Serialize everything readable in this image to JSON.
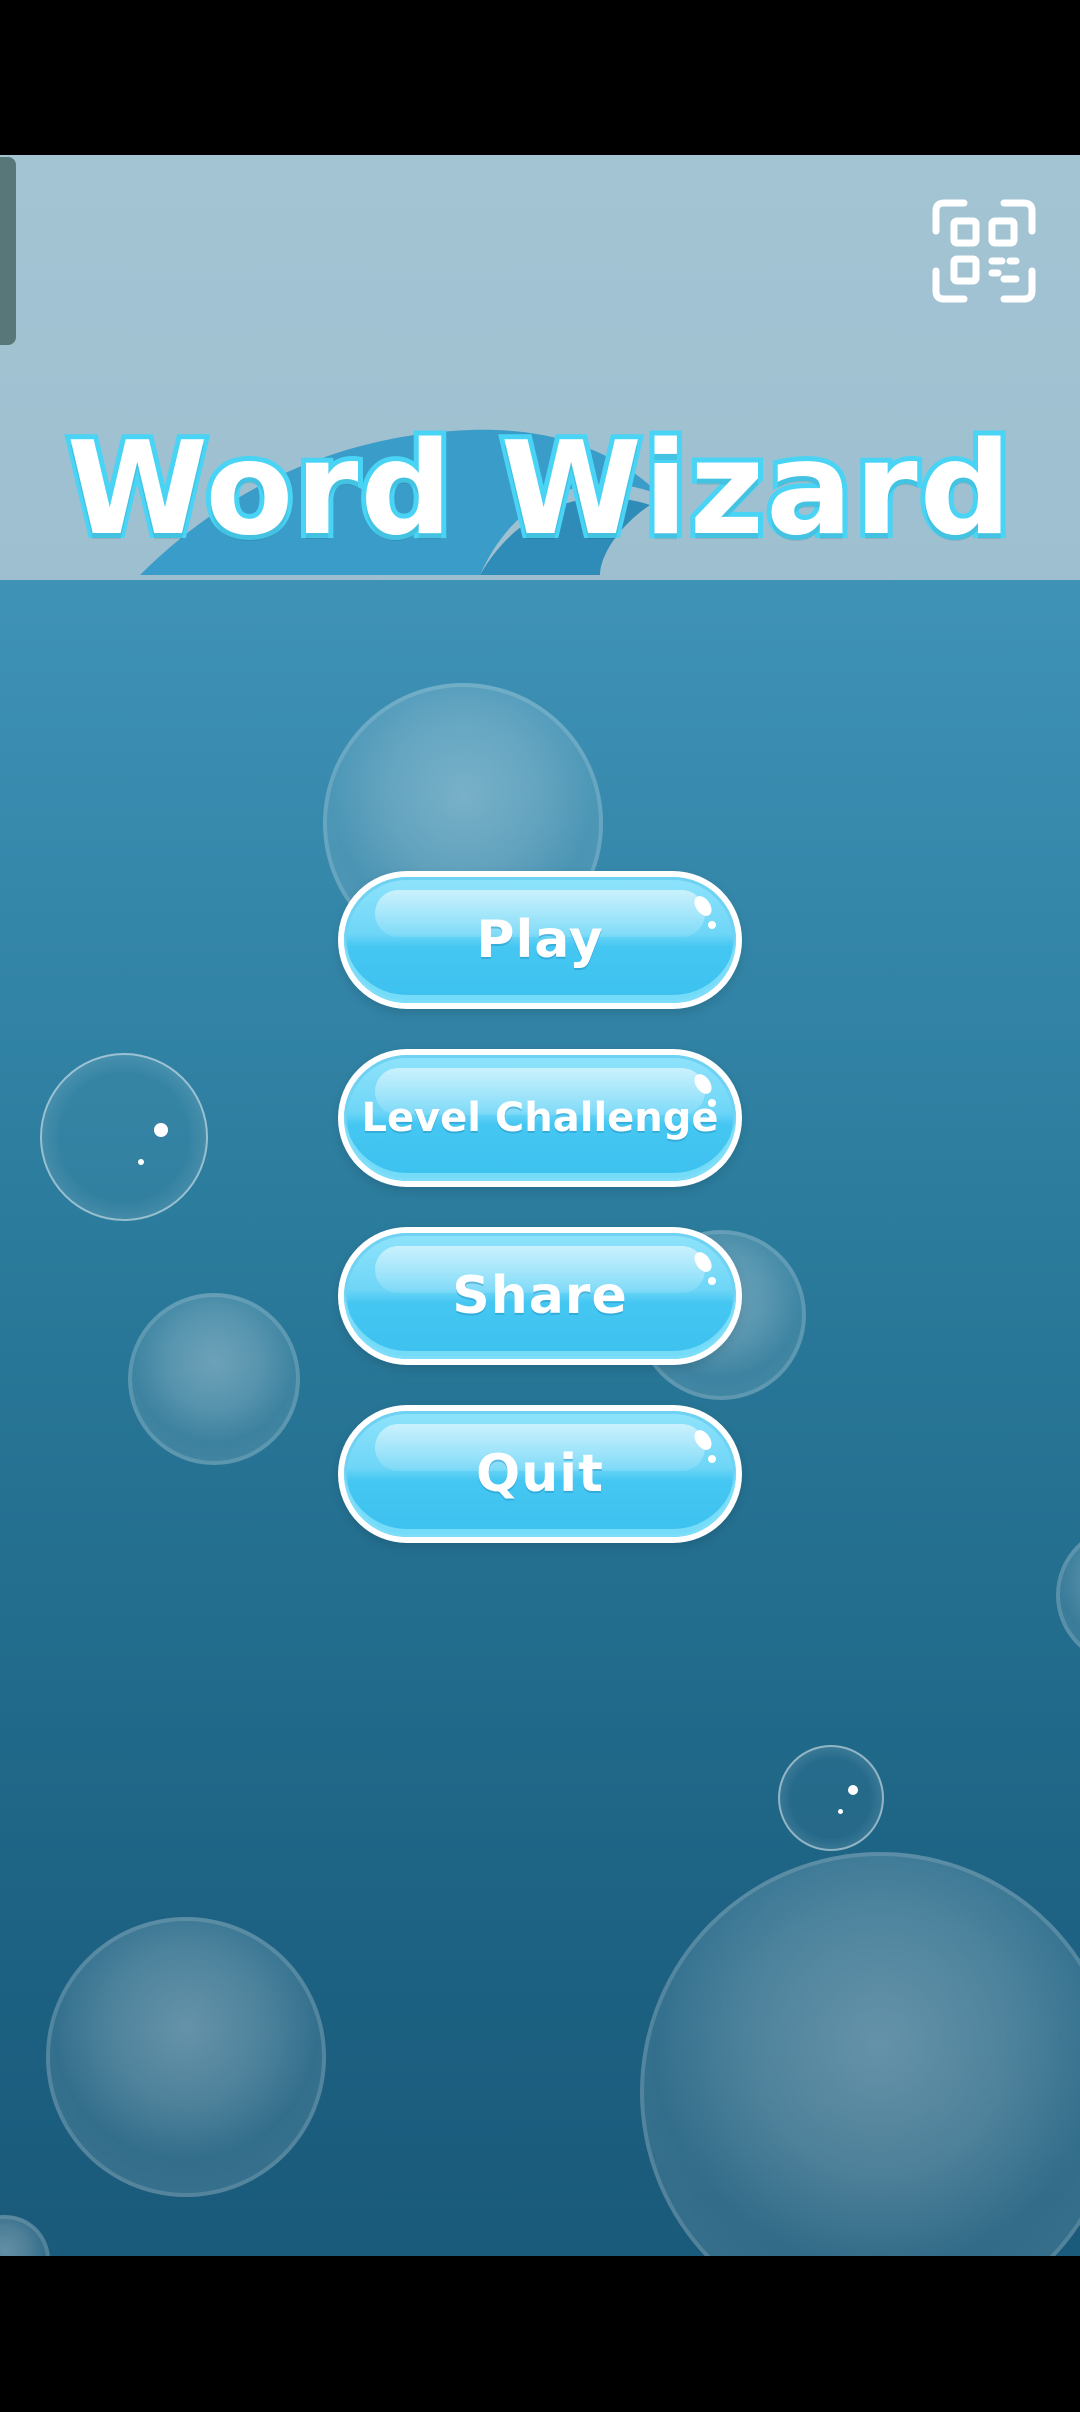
{
  "app": {
    "title": "Word Wizard"
  },
  "menu": {
    "play_label": "Play",
    "level_challenge_label": "Level Challenge",
    "share_label": "Share",
    "quit_label": "Quit"
  },
  "icons": {
    "scan": "qr-scan-icon"
  },
  "colors": {
    "title_outline": "#49d3f5",
    "button_fill": "#45c7f2",
    "water_top": "#4aa2c6",
    "water_bottom": "#1a5a7a",
    "sky": "#a3c4d3"
  }
}
